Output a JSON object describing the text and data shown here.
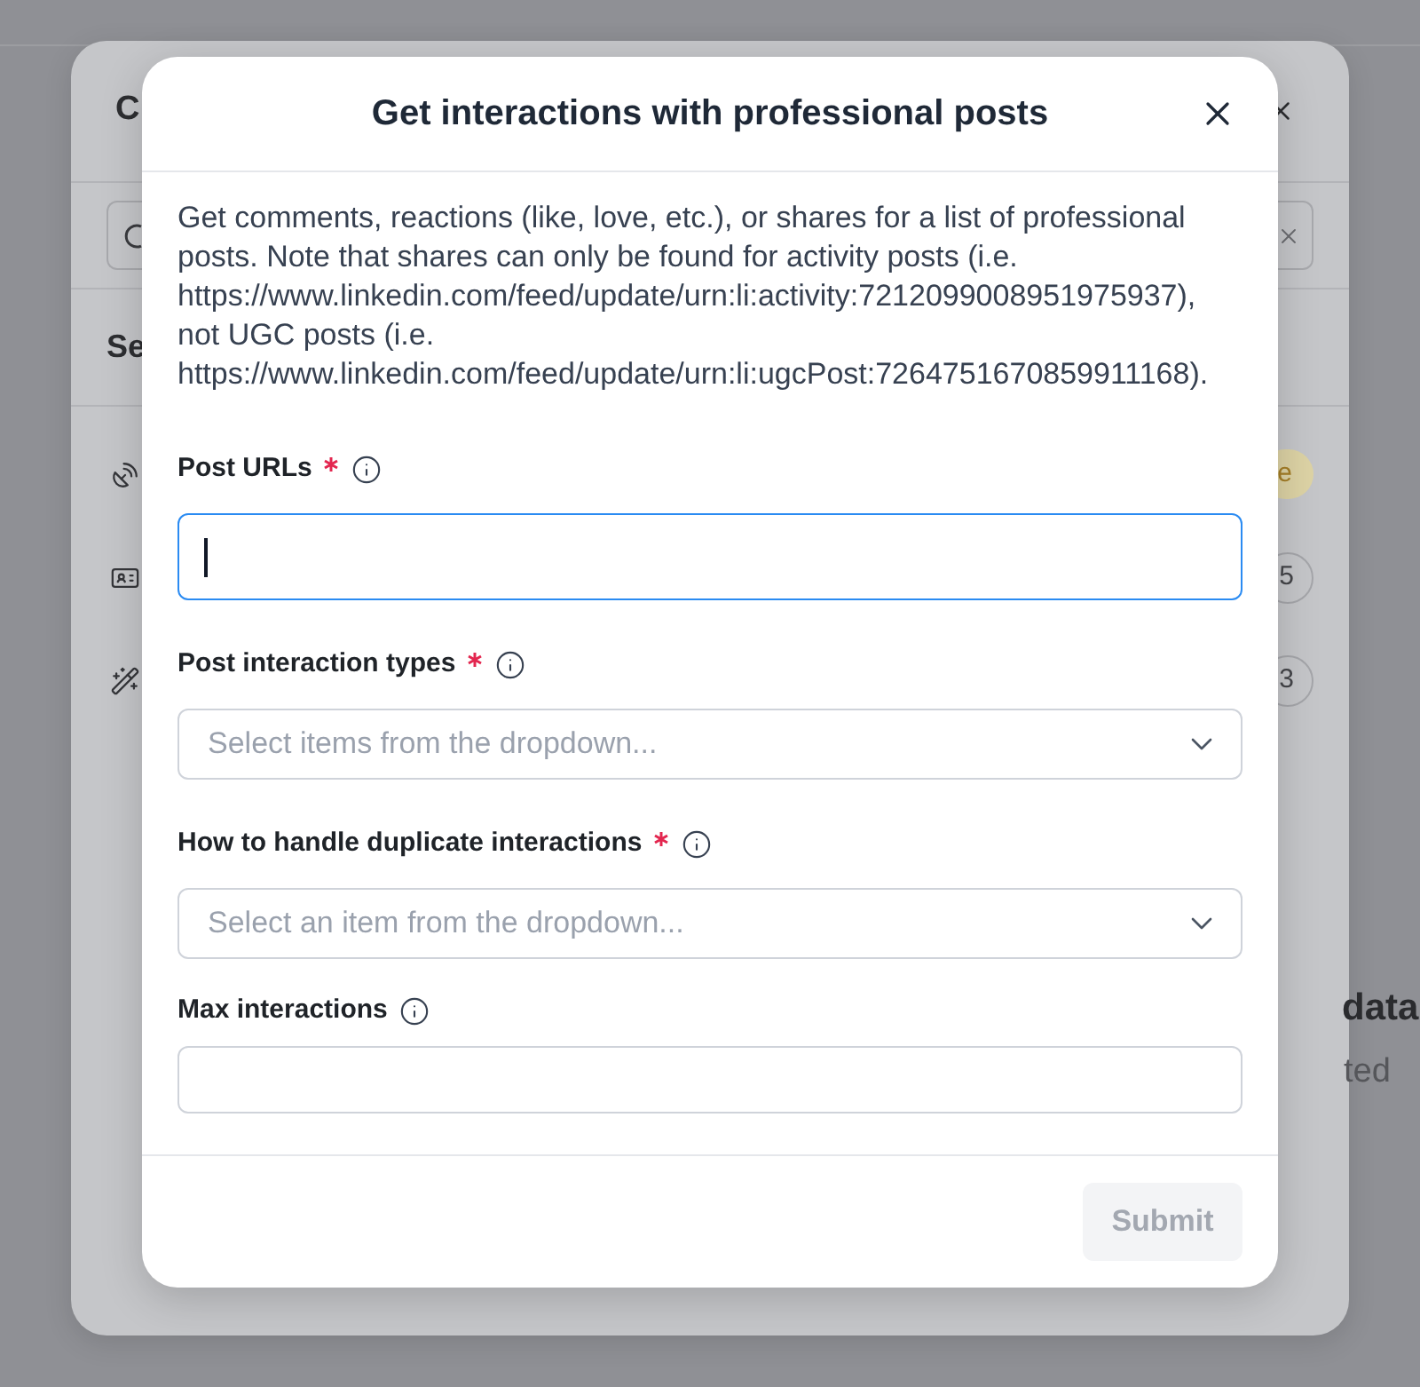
{
  "background_page": {
    "heading": "data",
    "caption": "ted"
  },
  "back_dialog": {
    "title": "C",
    "section_heading": "Se",
    "rows": [
      {
        "kind": "status",
        "badge": "e"
      },
      {
        "kind": "count",
        "badge": "5"
      },
      {
        "kind": "count",
        "badge": "3"
      }
    ]
  },
  "modal": {
    "title": "Get interactions with professional posts",
    "description": "Get comments, reactions (like, love, etc.), or shares for a list of professional posts. Note that shares can only be found for activity posts (i.e. https://www.linkedin.com/feed/update/urn:li:activity:7212099008951975937), not UGC posts (i.e. https://www.linkedin.com/feed/update/urn:li:ugcPost:7264751670859911168).",
    "fields": [
      {
        "label": "Post URLs",
        "required": true,
        "kind": "textarea",
        "focused": true
      },
      {
        "label": "Post interaction types",
        "required": true,
        "kind": "select",
        "focused": false,
        "placeholder": "Select items from the dropdown..."
      },
      {
        "label": "How to handle duplicate interactions",
        "required": true,
        "kind": "select",
        "focused": false,
        "placeholder": "Select an item from the dropdown..."
      },
      {
        "label": "Max interactions",
        "required": false,
        "kind": "text",
        "focused": false
      }
    ],
    "submit": {
      "label": "Submit",
      "disabled": true
    }
  }
}
